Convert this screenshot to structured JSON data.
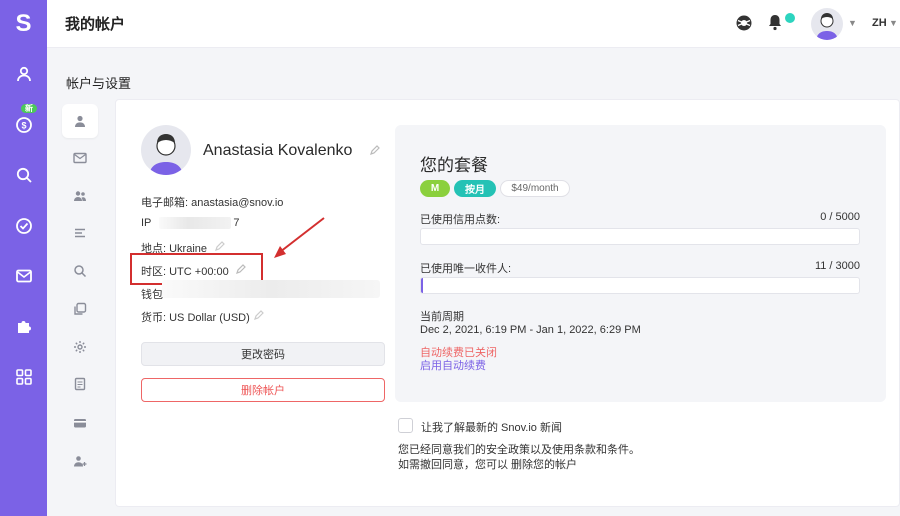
{
  "app": {
    "logo": "S",
    "page_title": "我的帐户",
    "lang": "ZH",
    "brand_color": "#7b62e6"
  },
  "rail": {
    "items": [
      {
        "icon": "user-icon"
      },
      {
        "icon": "dollar-icon",
        "badge": "新"
      },
      {
        "icon": "search-icon"
      },
      {
        "icon": "check-circle-icon"
      },
      {
        "icon": "mail-icon"
      },
      {
        "icon": "puzzle-icon"
      },
      {
        "icon": "grid-icon"
      }
    ]
  },
  "section_title": "帐户与设置",
  "subnav": [
    "user-icon",
    "mail-icon",
    "users-icon",
    "list-icon",
    "search-icon",
    "copy-icon",
    "gear-icon",
    "document-icon",
    "card-icon",
    "add-user-icon"
  ],
  "profile": {
    "name": "Anastasia Kovalenko",
    "email_label": "电子邮箱: anastasia@snov.io",
    "ip_prefix": "IP",
    "ip_suffix": "7",
    "location": "地点: Ukraine",
    "timezone": "时区: UTC +00:00",
    "wallet": "钱包",
    "currency": "货币: US Dollar (USD)",
    "change_password": "更改密码",
    "delete_account": "删除帐户"
  },
  "plan": {
    "title": "您的套餐",
    "tier": "M",
    "billing": "按月",
    "price": "$49/month",
    "credits": {
      "label": "已使用信用点数:",
      "count": "0 / 5000",
      "used_fraction": 0.0
    },
    "recipients": {
      "label": "已使用唯一收件人:",
      "count": "11 / 3000",
      "used_fraction": 0.0037
    },
    "period_label": "当前周期",
    "period_value": "Dec 2, 2021, 6:19 PM - Jan 1, 2022, 6:29 PM",
    "auto_renew_off": "自动续费已关闭",
    "enable_auto_renew": "启用自动续费"
  },
  "newsletter_label": "让我了解最新的 Snov.io 新闻",
  "consent_line1": "您已经同意我们的安全政策以及使用条款和条件。",
  "consent_line2": "如需撤回同意，您可以 删除您的帐户"
}
